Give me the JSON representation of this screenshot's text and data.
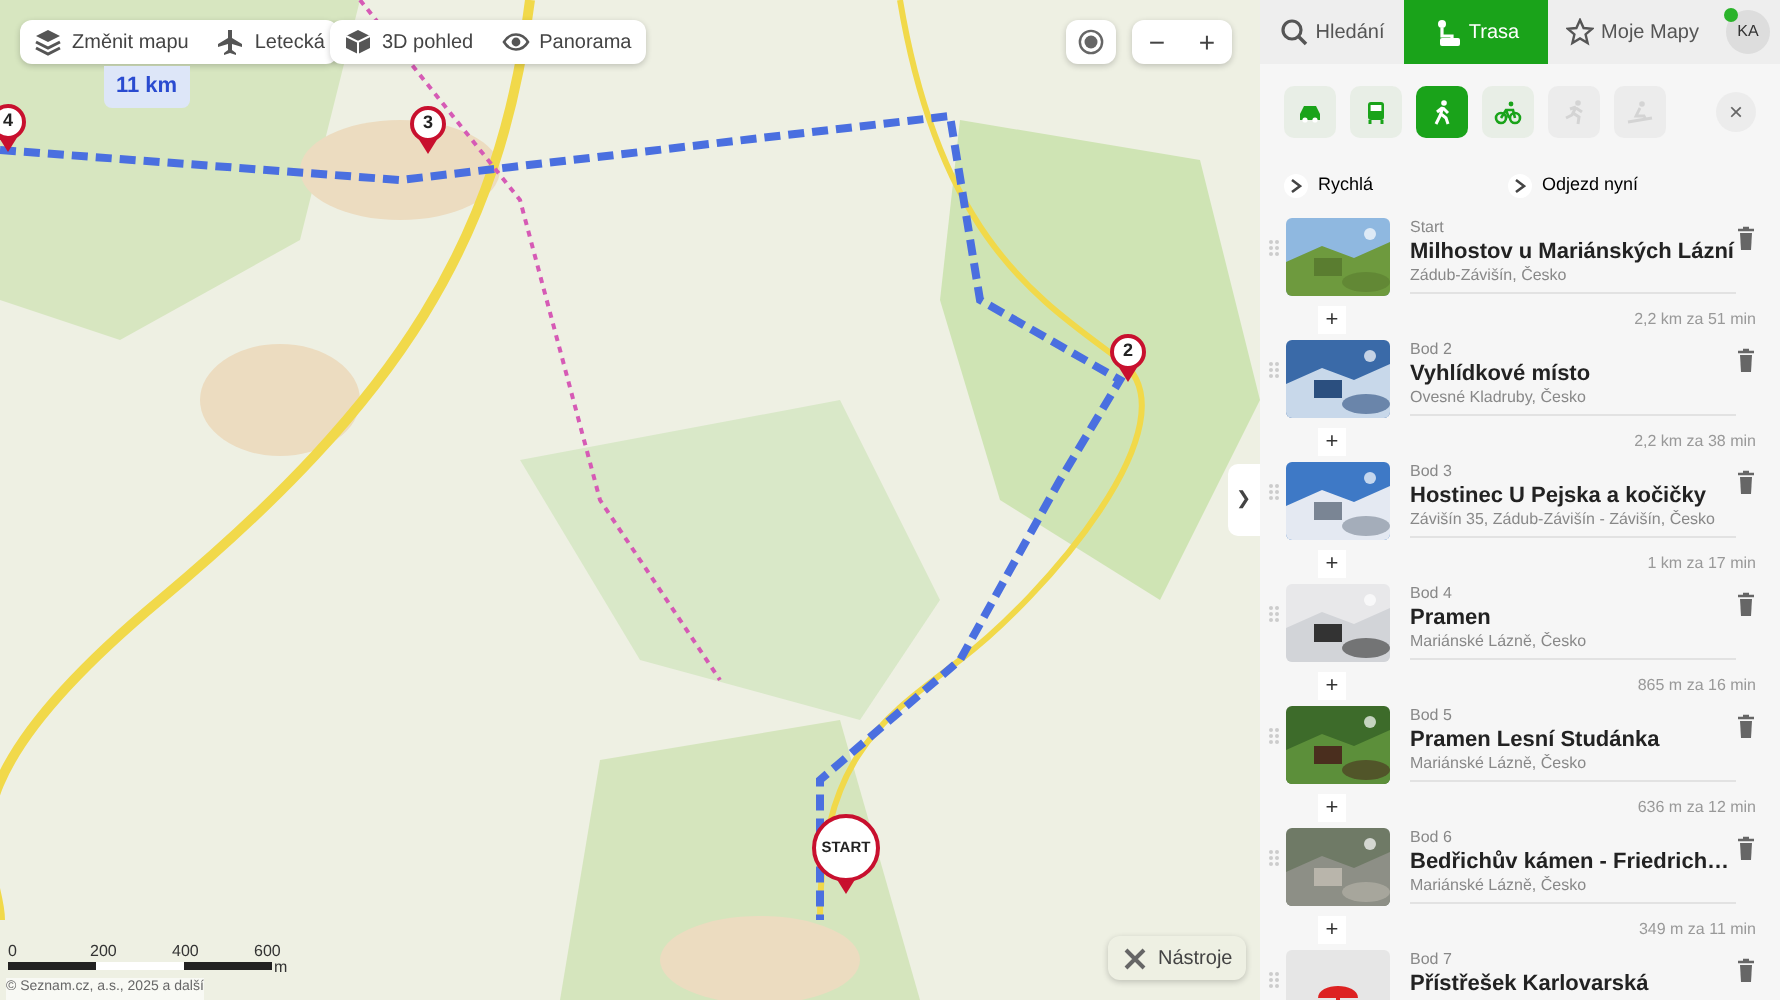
{
  "map": {
    "kind": "picture"
  },
  "map_controls": [
    {
      "kind": "layers",
      "label": "Změnit mapu"
    },
    {
      "kind": "plane",
      "label": "Letecká"
    },
    {
      "kind": "cube",
      "label": "3D pohled"
    },
    {
      "kind": "eye",
      "label": "Panorama"
    }
  ],
  "route_tooltip": {
    "distance": "11 km"
  },
  "markers": [
    {
      "label": "4",
      "kind": "point"
    },
    {
      "label": "3",
      "kind": "point"
    },
    {
      "label": "2",
      "kind": "point"
    },
    {
      "label": "START",
      "kind": "start"
    }
  ],
  "zoom": {
    "minus": "−",
    "plus": "+"
  },
  "scale": {
    "ticks": [
      "0",
      "200",
      "400",
      "600"
    ],
    "unit": "m"
  },
  "copyright": "© Seznam.cz, a.s., 2025 a další",
  "tools_button": {
    "label": "Nástroje"
  },
  "panel_toggle": "❯",
  "tabs": [
    {
      "kind": "search",
      "label": "Hledání",
      "selected": false
    },
    {
      "kind": "route",
      "label": "Trasa",
      "selected": true
    },
    {
      "kind": "star",
      "label": "Moje Mapy",
      "selected": false
    }
  ],
  "user": {
    "initials": "KA",
    "online": true
  },
  "modes": [
    {
      "kind": "car",
      "selected": false,
      "disabled": false
    },
    {
      "kind": "bus",
      "selected": false,
      "disabled": false
    },
    {
      "kind": "walk",
      "selected": true,
      "disabled": false
    },
    {
      "kind": "bike",
      "selected": false,
      "disabled": false
    },
    {
      "kind": "run",
      "selected": false,
      "disabled": true
    },
    {
      "kind": "ski",
      "selected": false,
      "disabled": true
    }
  ],
  "close": "×",
  "add_stop": "+",
  "options": [
    "Rychlá",
    "Odjezd nyní"
  ],
  "waypoints": [
    {
      "caption": "Start",
      "name": "Milhostov u Mariánských Lázní",
      "place": "Zádub-Závišín, Česko",
      "leg": "2,2 km za 51 min"
    },
    {
      "caption": "Bod 2",
      "name": "Vyhlídkové místo",
      "place": "Ovesné Kladruby, Česko",
      "leg": "2,2 km za 38 min"
    },
    {
      "caption": "Bod 3",
      "name": "Hostinec U Pejska a kočičky",
      "place": "Závišín 35, Zádub-Závišín - Závišín, Česko",
      "leg": "1 km za 17 min"
    },
    {
      "caption": "Bod 4",
      "name": "Pramen",
      "place": "Mariánské Lázně, Česko",
      "leg": "865 m za 16 min"
    },
    {
      "caption": "Bod 5",
      "name": "Pramen Lesní Studánka",
      "place": "Mariánské Lázně, Česko",
      "leg": "636 m za 12 min"
    },
    {
      "caption": "Bod 6",
      "name": "Bedřichův kámen - Friedrich…",
      "place": "Mariánské Lázně, Česko",
      "leg": "349 m za 11 min"
    },
    {
      "caption": "Bod 7",
      "name": "Přístřešek Karlovarská"
    }
  ]
}
